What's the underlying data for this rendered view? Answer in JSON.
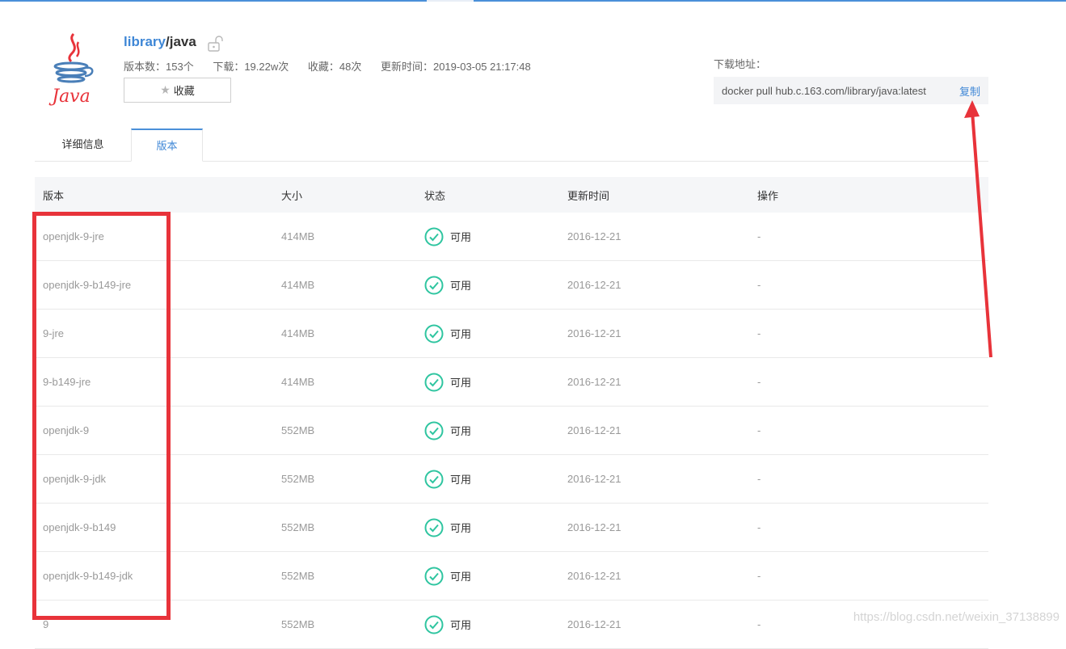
{
  "repo": {
    "logo_text": "Java",
    "namespace": "library",
    "separator": "/",
    "name": "java",
    "meta": {
      "versions": "版本数：153个",
      "downloads": "下载：19.22w次",
      "favorites": "收藏：48次",
      "updated": "更新时间：2019-03-05 21:17:48"
    },
    "favorite_button": "收藏"
  },
  "download": {
    "label": "下载地址：",
    "command": "docker pull hub.c.163.com/library/java:latest",
    "copy_label": "复制"
  },
  "tabs": [
    {
      "label": "详细信息",
      "active": false
    },
    {
      "label": "版本",
      "active": true
    }
  ],
  "table": {
    "headers": [
      "版本",
      "大小",
      "状态",
      "更新时间",
      "操作"
    ],
    "rows": [
      {
        "version": "openjdk-9-jre",
        "size": "414MB",
        "status": "可用",
        "updated": "2016-12-21",
        "action": "-"
      },
      {
        "version": "openjdk-9-b149-jre",
        "size": "414MB",
        "status": "可用",
        "updated": "2016-12-21",
        "action": "-"
      },
      {
        "version": "9-jre",
        "size": "414MB",
        "status": "可用",
        "updated": "2016-12-21",
        "action": "-"
      },
      {
        "version": "9-b149-jre",
        "size": "414MB",
        "status": "可用",
        "updated": "2016-12-21",
        "action": "-"
      },
      {
        "version": "openjdk-9",
        "size": "552MB",
        "status": "可用",
        "updated": "2016-12-21",
        "action": "-"
      },
      {
        "version": "openjdk-9-jdk",
        "size": "552MB",
        "status": "可用",
        "updated": "2016-12-21",
        "action": "-"
      },
      {
        "version": "openjdk-9-b149",
        "size": "552MB",
        "status": "可用",
        "updated": "2016-12-21",
        "action": "-"
      },
      {
        "version": "openjdk-9-b149-jdk",
        "size": "552MB",
        "status": "可用",
        "updated": "2016-12-21",
        "action": "-"
      },
      {
        "version": "9",
        "size": "552MB",
        "status": "可用",
        "updated": "2016-12-21",
        "action": "-"
      }
    ]
  },
  "watermark": "https://blog.csdn.net/weixin_37138899",
  "colors": {
    "accent": "#3f87d6",
    "status_ok": "#2fc5a0",
    "annotation": "#e8333a"
  },
  "icons": {
    "lock": "lock-icon",
    "star": "star-icon",
    "status": "check-circle-icon"
  }
}
